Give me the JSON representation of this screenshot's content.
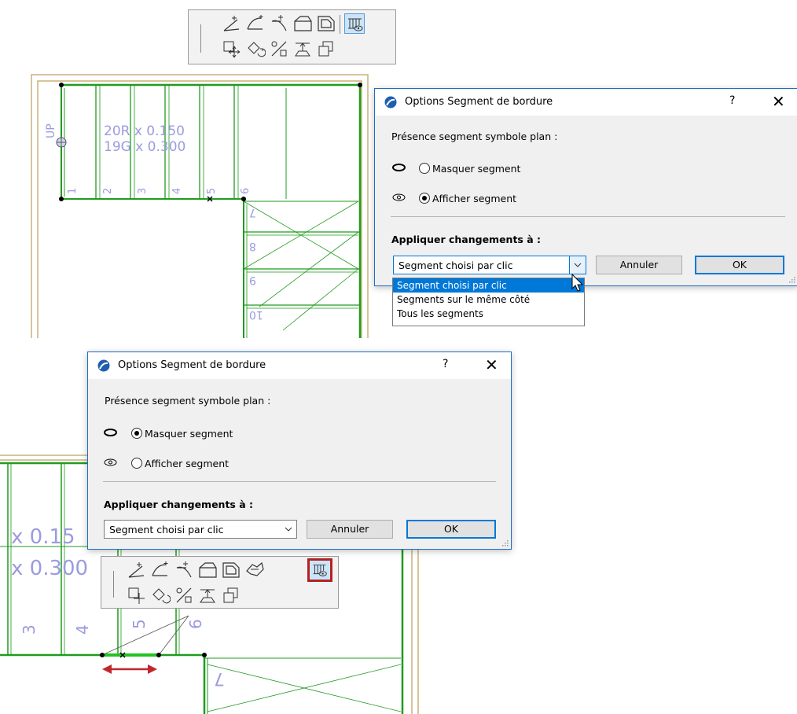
{
  "top_toolbar": {
    "row1_icons": [
      "add-arc-node-icon",
      "curve-edge-icon",
      "tangent-arc-icon",
      "offset-edge-icon",
      "offset-all-edges-icon"
    ],
    "row2_icons": [
      "move-node-icon",
      "rotate-icon",
      "split-segment-icon",
      "elevate-icon",
      "copy-icon"
    ],
    "toggle_icon": "segment-visibility-icon"
  },
  "plan_top": {
    "labels": [
      "20R x 0.150",
      "19G x 0.300",
      "UP"
    ],
    "riser_numbers": [
      "1",
      "2",
      "3",
      "4",
      "5",
      "6",
      "7",
      "8",
      "9",
      "10"
    ]
  },
  "dialog_top": {
    "title": "Options Segment de bordure",
    "help": "?",
    "close": "✕",
    "presence_label": "Présence segment symbole plan :",
    "hide_label": "Masquer segment",
    "show_label": "Afficher segment",
    "hide_selected": false,
    "show_selected": true,
    "apply_label": "Appliquer changements à :",
    "combo_value": "Segment choisi par clic",
    "cancel": "Annuler",
    "ok": "OK",
    "dropdown_options": [
      "Segment choisi par clic",
      "Segments sur le même côté",
      "Tous les segments"
    ],
    "dropdown_selected": 0
  },
  "dialog_bottom": {
    "title": "Options Segment de bordure",
    "help": "?",
    "close": "✕",
    "presence_label": "Présence segment symbole plan :",
    "hide_label": "Masquer segment",
    "show_label": "Afficher segment",
    "hide_selected": true,
    "show_selected": false,
    "apply_label": "Appliquer changements à :",
    "combo_value": "Segment choisi par clic",
    "cancel": "Annuler",
    "ok": "OK"
  },
  "plan_bottom": {
    "labels": [
      "x 0.15",
      "x 0.300"
    ],
    "riser_numbers": [
      "3",
      "4",
      "5",
      "6",
      "7"
    ]
  },
  "bottom_toolbar": {
    "row1_icons": [
      "add-arc-node-icon",
      "curve-edge-icon",
      "tangent-arc-icon",
      "offset-edge-icon",
      "offset-all-edges-icon",
      "fillet-icon"
    ],
    "row2_icons": [
      "move-node-icon",
      "rotate-icon",
      "split-segment-icon",
      "elevate-icon",
      "copy-icon"
    ],
    "toggle_icon": "segment-visibility-icon",
    "highlight_color": "#b22222"
  },
  "colors": {
    "wall_green": "#1f9b1f",
    "plan_text": "#9b9be0",
    "accent_blue": "#0078d7",
    "arrow_red": "#c0272d"
  }
}
